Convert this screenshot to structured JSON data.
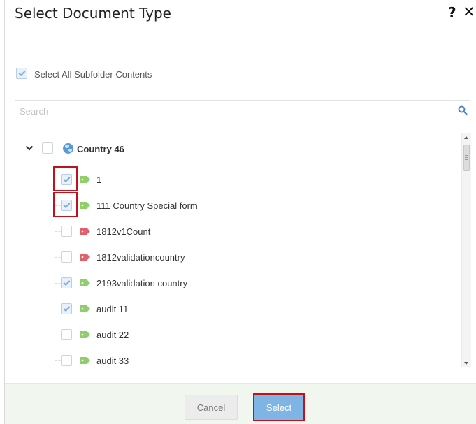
{
  "dialog": {
    "title": "Select Document Type",
    "help_glyph": "?",
    "close_glyph": "✕"
  },
  "select_all": {
    "label": "Select All Subfolder Contents",
    "checked": true
  },
  "search": {
    "placeholder": "Search",
    "value": ""
  },
  "tree": {
    "root": {
      "label": "Country 46",
      "expanded": true,
      "checked": false,
      "icon": "globe-icon"
    },
    "items": [
      {
        "label": "1",
        "checked": true,
        "tag_color": "#8fcf6a",
        "highlighted": true
      },
      {
        "label": "111 Country Special form",
        "checked": true,
        "tag_color": "#8fcf6a",
        "highlighted": true
      },
      {
        "label": "1812v1Count",
        "checked": false,
        "tag_color": "#e0606e",
        "highlighted": false
      },
      {
        "label": "1812validationcountry",
        "checked": false,
        "tag_color": "#e0606e",
        "highlighted": false
      },
      {
        "label": "2193validation country",
        "checked": true,
        "tag_color": "#8fcf6a",
        "highlighted": false
      },
      {
        "label": "audit 11",
        "checked": true,
        "tag_color": "#8fcf6a",
        "highlighted": false
      },
      {
        "label": "audit 22",
        "checked": false,
        "tag_color": "#8fcf6a",
        "highlighted": false
      },
      {
        "label": "audit 33",
        "checked": false,
        "tag_color": "#8fcf6a",
        "highlighted": false
      }
    ]
  },
  "footer": {
    "cancel_label": "Cancel",
    "select_label": "Select"
  },
  "colors": {
    "highlight_border": "#c0121c",
    "select_button": "#7fb5e4",
    "footer_bg": "#f1f7ef"
  }
}
